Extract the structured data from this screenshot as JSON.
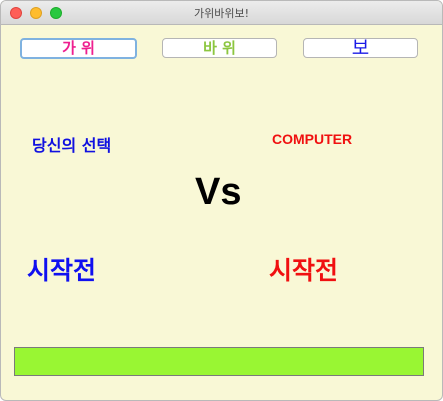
{
  "window": {
    "title": "가위바위보!"
  },
  "choices": {
    "scissors_label": "가 위",
    "rock_label": "바 위",
    "paper_label": "보"
  },
  "labels": {
    "you": "당신의 선택",
    "computer": "COMPUTER",
    "vs": "Vs"
  },
  "status": {
    "you": "시작전",
    "computer": "시작전"
  },
  "result": {
    "text": ""
  },
  "colors": {
    "background": "#f9f8d6",
    "scissors": "#ee1f8f",
    "rock": "#8cc63f",
    "paper": "#1a1ae6",
    "you": "#1010e0",
    "computer": "#f01010",
    "result_bar": "#99f633"
  }
}
